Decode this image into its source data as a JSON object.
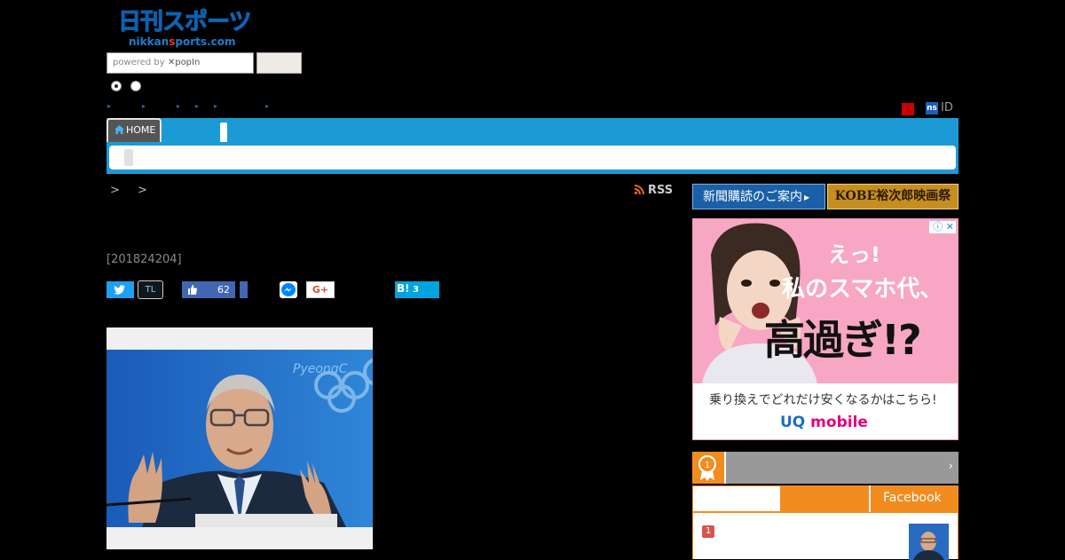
{
  "header": {
    "logo_main": "日刊スポーツ",
    "logo_url_pre": "nikkan",
    "logo_url_accent": "s",
    "logo_url_post": "ports.com",
    "search_powered": "powered by",
    "search_brand": "popIn",
    "search_button_label": "",
    "id_badge": "ns",
    "id_label": "ID"
  },
  "nav": {
    "home_label": "HOME"
  },
  "breadcrumb": ">  >",
  "rss_label": "RSS",
  "article": {
    "date": "[201824204]"
  },
  "social": {
    "tl_label": "TL",
    "fb_count": "62",
    "gplus_label": "G+",
    "hatena_label": "B!",
    "hatena_count": "3"
  },
  "sidebar": {
    "subscribe_label": "新聞購読のご案内",
    "kobe_label": "KOBE裕次郎映画祭",
    "ad": {
      "line1": "えっ!",
      "line2": "私のスマホ代、",
      "line3": "高過ぎ!?",
      "line4": "乗り換えでどれだけ安くなるかはこちら!",
      "brand_uq": "UQ",
      "brand_mobile": " mobile"
    },
    "ranking": {
      "arrow": "›",
      "tab_facebook": "Facebook",
      "item1_rank": "1",
      "medal_num": "1"
    }
  },
  "colors": {
    "nav_blue": "#1b9ad6",
    "orange": "#f28c1e",
    "facebook": "#4267b2",
    "twitter": "#1da1f2"
  }
}
